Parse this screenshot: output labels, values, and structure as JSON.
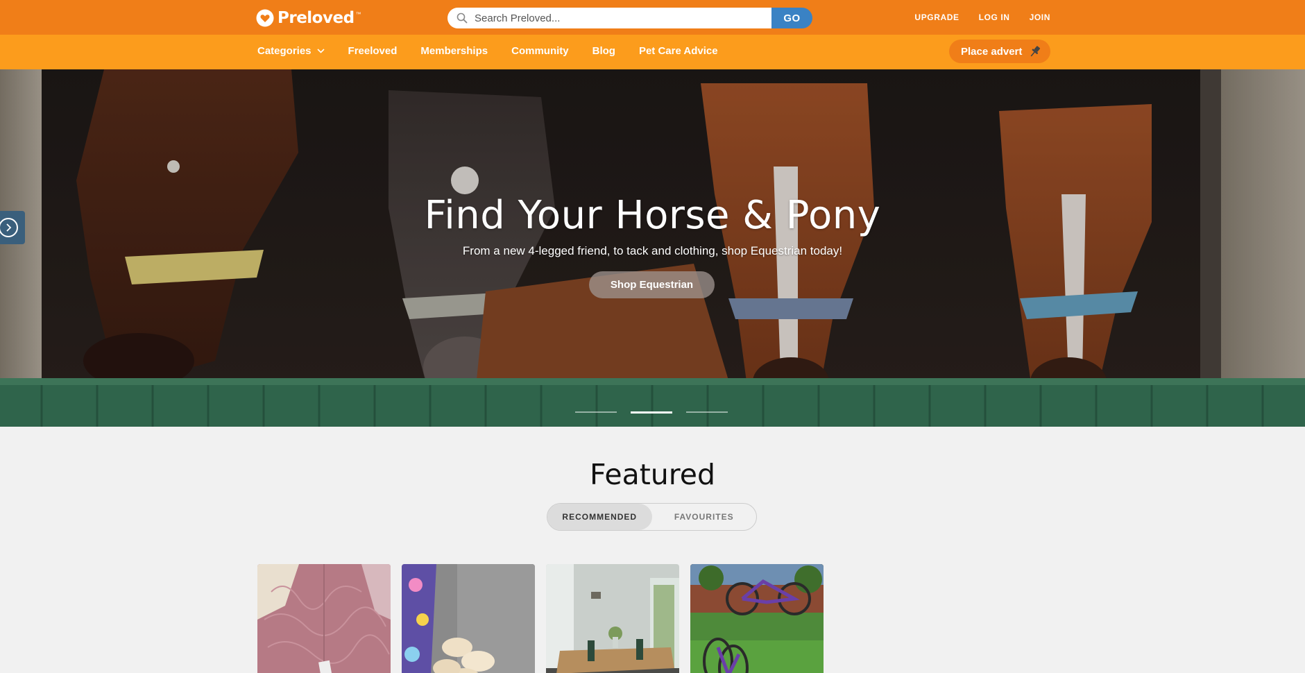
{
  "header": {
    "logo_text": "Preloved",
    "logo_tm": "™",
    "search": {
      "placeholder": "Search Preloved...",
      "go_label": "GO"
    },
    "links": [
      {
        "label": "UPGRADE"
      },
      {
        "label": "LOG IN"
      },
      {
        "label": "JOIN"
      }
    ]
  },
  "nav": {
    "items": [
      {
        "label": "Categories",
        "has_dropdown": true
      },
      {
        "label": "Freeloved"
      },
      {
        "label": "Memberships"
      },
      {
        "label": "Community"
      },
      {
        "label": "Blog"
      },
      {
        "label": "Pet Care Advice"
      }
    ],
    "place_advert": "Place advert"
  },
  "hero": {
    "title": "Find Your Horse & Pony",
    "subtitle": "From a new 4-legged friend, to tack and clothing, shop Equestrian today!",
    "cta": "Shop Equestrian",
    "slides_count": 3,
    "active_slide": 2
  },
  "featured": {
    "title": "Featured",
    "tabs": [
      {
        "label": "RECOMMENDED",
        "active": true
      },
      {
        "label": "FAVOURITES",
        "active": false
      }
    ],
    "listings": [
      {
        "image": "pink lace dress"
      },
      {
        "image": "litter of puppies on blanket"
      },
      {
        "image": "dining room table"
      },
      {
        "image": "purple bicycle on lawn"
      }
    ]
  },
  "colors": {
    "topbar": "#f07e18",
    "navbar": "#fc9c1c",
    "go_button": "#3a82c4",
    "page_bg": "#f1f1f1"
  }
}
